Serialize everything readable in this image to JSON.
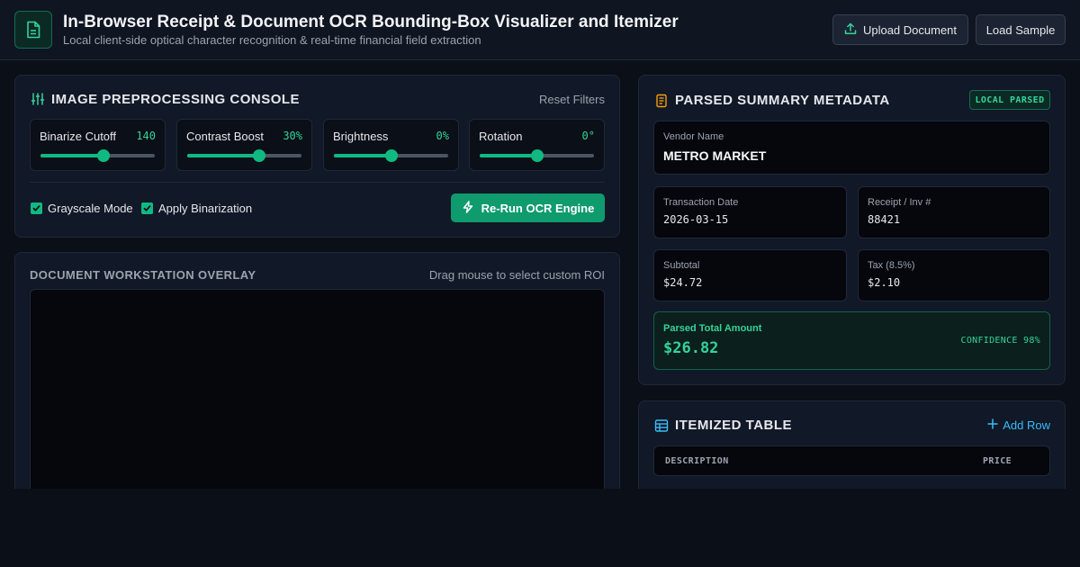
{
  "header": {
    "title": "In-Browser Receipt & Document OCR Bounding-Box Visualizer and Itemizer",
    "subtitle": "Local client-side optical character recognition & real-time financial field extraction",
    "upload_label": "Upload Document",
    "sample_label": "Load Sample"
  },
  "preprocessing": {
    "title": "IMAGE PREPROCESSING CONSOLE",
    "reset_label": "Reset Filters",
    "sliders": [
      {
        "label": "Binarize Cutoff",
        "value": "140",
        "level": 0.55
      },
      {
        "label": "Contrast Boost",
        "value": "30%",
        "level": 0.63
      },
      {
        "label": "Brightness",
        "value": "0%",
        "level": 0.5
      },
      {
        "label": "Rotation",
        "value": "0°",
        "level": 0.5
      }
    ],
    "checkboxes": [
      {
        "label": "Grayscale Mode",
        "checked": true
      },
      {
        "label": "Apply Binarization",
        "checked": true
      }
    ],
    "rerun_label": "Re-Run OCR Engine"
  },
  "workstation": {
    "title": "DOCUMENT WORKSTATION OVERLAY",
    "hint": "Drag mouse to select custom ROI"
  },
  "metadata": {
    "title": "PARSED SUMMARY METADATA",
    "badge": "LOCAL PARSED",
    "vendor_label": "Vendor Name",
    "vendor_value": "METRO MARKET",
    "date_label": "Transaction Date",
    "date_value": "2026-03-15",
    "receipt_label": "Receipt / Inv #",
    "receipt_value": "88421",
    "subtotal_label": "Subtotal",
    "subtotal_value": "$24.72",
    "tax_label": "Tax (8.5%)",
    "tax_value": "$2.10",
    "total_label": "Parsed Total Amount",
    "total_value": "$26.82",
    "confidence": "CONFIDENCE 98%"
  },
  "itemized": {
    "title": "ITEMIZED TABLE",
    "add_row_label": "Add Row",
    "columns": [
      "DESCRIPTION",
      "PRICE"
    ]
  },
  "colors": {
    "accent": "#10b981",
    "accent_text": "#34d399",
    "link": "#38bdf8",
    "background": "#0b0f17",
    "panel": "#111827"
  }
}
